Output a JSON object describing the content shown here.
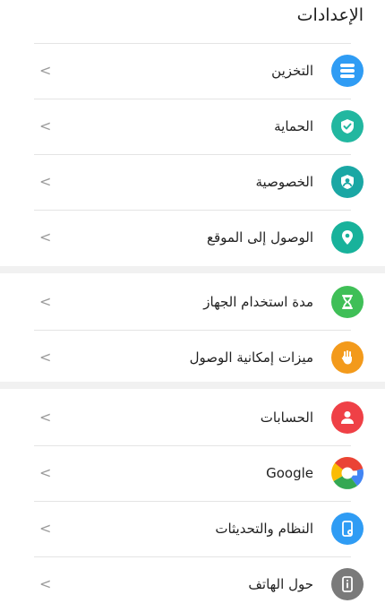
{
  "page": {
    "title": "الإعدادات"
  },
  "groups": [
    {
      "items": [
        {
          "label": "التخزين",
          "icon": "storage-icon",
          "color": "#2f9cf4"
        },
        {
          "label": "الحماية",
          "icon": "shield-check-icon",
          "color": "#22b7a0"
        },
        {
          "label": "الخصوصية",
          "icon": "privacy-icon",
          "color": "#1aa7a4"
        },
        {
          "label": "الوصول إلى الموقع",
          "icon": "location-pin-icon",
          "color": "#18b29b"
        }
      ]
    },
    {
      "items": [
        {
          "label": "مدة استخدام الجهاز",
          "icon": "hourglass-icon",
          "color": "#3fbf57"
        },
        {
          "label": "ميزات إمكانية الوصول",
          "icon": "hand-icon",
          "color": "#f39a1b"
        }
      ]
    },
    {
      "items": [
        {
          "label": "الحسابات",
          "icon": "person-icon",
          "color": "#ef4046"
        },
        {
          "label": "Google",
          "icon": "google-icon",
          "color": "#4285f4"
        },
        {
          "label": "النظام والتحديثات",
          "icon": "system-update-icon",
          "color": "#2f9cf4"
        },
        {
          "label": "حول الهاتف",
          "icon": "phone-info-icon",
          "color": "#7a7a7a"
        }
      ]
    }
  ],
  "chevron": "<"
}
